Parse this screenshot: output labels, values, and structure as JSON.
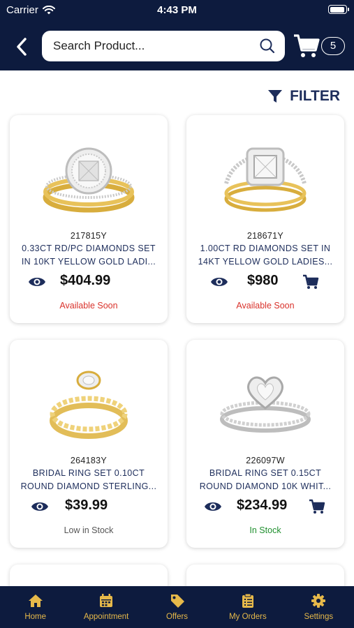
{
  "status": {
    "carrier": "Carrier",
    "time": "4:43 PM",
    "battery_level": 0.95
  },
  "header": {
    "search_placeholder": "Search Product...",
    "cart_count": "5"
  },
  "filter_label": "FILTER",
  "products": [
    {
      "sku": "217815Y",
      "name": "0.33CT RD/PC DIAMONDS SET IN 10KT YELLOW GOLD LADI...",
      "price": "$404.99",
      "stock": "Available Soon",
      "stock_color": "#d9322b",
      "has_cart": false
    },
    {
      "sku": "218671Y",
      "name": "1.00CT RD DIAMONDS SET IN 14KT YELLOW GOLD LADIES...",
      "price": "$980",
      "stock": "Available Soon",
      "stock_color": "#d9322b",
      "has_cart": true
    },
    {
      "sku": "264183Y",
      "name": "BRIDAL RING SET 0.10CT ROUND DIAMOND STERLING...",
      "price": "$39.99",
      "stock": "Low in Stock",
      "stock_color": "#555555",
      "has_cart": false
    },
    {
      "sku": "226097W",
      "name": "BRIDAL RING SET 0.15CT ROUND DIAMOND 10K WHIT...",
      "price": "$234.99",
      "stock": "In Stock",
      "stock_color": "#1f8f2e",
      "has_cart": true
    }
  ],
  "nav": [
    {
      "label": "Home",
      "icon": "home-icon"
    },
    {
      "label": "Appointment",
      "icon": "calendar-icon"
    },
    {
      "label": "Offers",
      "icon": "tag-icon"
    },
    {
      "label": "My Orders",
      "icon": "clipboard-icon"
    },
    {
      "label": "Settings",
      "icon": "gear-icon"
    }
  ],
  "colors": {
    "navy": "#0d1b3e",
    "accent_gold": "#e6b94a",
    "title_blue": "#1d2d5b"
  }
}
